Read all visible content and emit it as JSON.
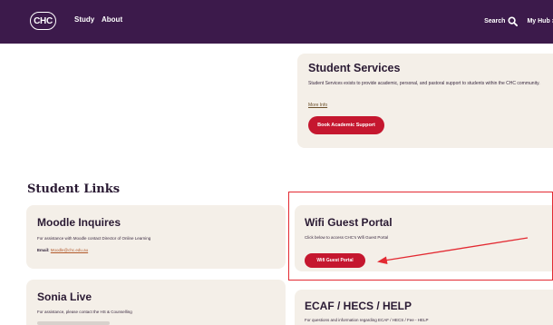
{
  "nav": {
    "logo": "CHC",
    "study": "Study",
    "about": "About",
    "search": "Search",
    "myhub": "My Hub"
  },
  "student_services": {
    "title": "Student Services",
    "description": "Student Services exists to provide academic, personal, and pastoral support to students within the CHC community.",
    "more_info": "More Info",
    "button": "Book Academic Support"
  },
  "student_links": {
    "heading": "Student Links",
    "moodle": {
      "title": "Moodle Inquires",
      "text": "For assistance with Moodle contact Director of Online Learning",
      "email_label": "Email:",
      "email": "Moodle@chc.edu.au"
    },
    "wifi": {
      "title": "Wifi Guest Portal",
      "text": "Click below to access CHC's Wifi Guest Portal",
      "button": "Wifi Guest Portal"
    },
    "sonia": {
      "title": "Sonia Live",
      "text": "For assistance, please contact the HS & Counselling"
    },
    "ecaf": {
      "title": "ECAF / HECS / HELP",
      "text": "For questions and information regarding ECAF / HECS / Fee - HELP"
    }
  },
  "colors": {
    "nav_bg": "#3c1a4b",
    "card_bg": "#f4efe8",
    "button_bg": "#c5172f",
    "annotation": "#e32a32"
  }
}
